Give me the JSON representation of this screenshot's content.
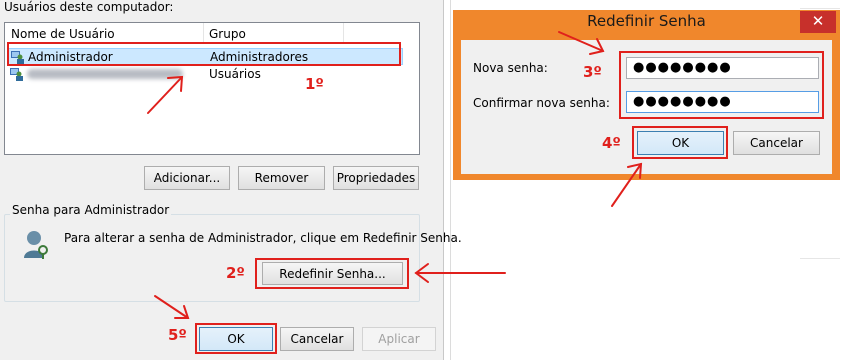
{
  "left_dialog": {
    "users_label": "Usuários deste computador:",
    "columns": [
      "Nome de Usuário",
      "Grupo"
    ],
    "rows": [
      {
        "name": "Administrador",
        "group": "Administradores"
      },
      {
        "name": "",
        "group": "Usuários"
      }
    ],
    "buttons": {
      "add": "Adicionar...",
      "remove": "Remover",
      "properties": "Propriedades"
    },
    "password_group_title": "Senha para Administrador",
    "password_hint": "Para alterar a senha de Administrador, clique em Redefinir Senha.",
    "reset_button": "Redefinir Senha...",
    "footer": {
      "ok": "OK",
      "cancel": "Cancelar",
      "apply": "Aplicar"
    }
  },
  "reset_dialog": {
    "title": "Redefinir Senha",
    "close_glyph": "✕",
    "new_password_label": "Nova senha:",
    "new_password_value": "●●●●●●●●",
    "confirm_password_label": "Confirmar nova senha:",
    "confirm_password_value": "●●●●●●●●",
    "ok": "OK",
    "cancel": "Cancelar"
  },
  "annotations": {
    "step1": "1º",
    "step2": "2º",
    "step3": "3º",
    "step4": "4º",
    "step5": "5º"
  },
  "colors": {
    "annotation_red": "#e0201c",
    "modal_frame": "#f0872c",
    "close_red": "#c7302b",
    "selection": "#cce8ff"
  },
  "icons": [
    "user-icon",
    "users-icon",
    "user-key-icon",
    "close-icon",
    "arrow-icon"
  ]
}
